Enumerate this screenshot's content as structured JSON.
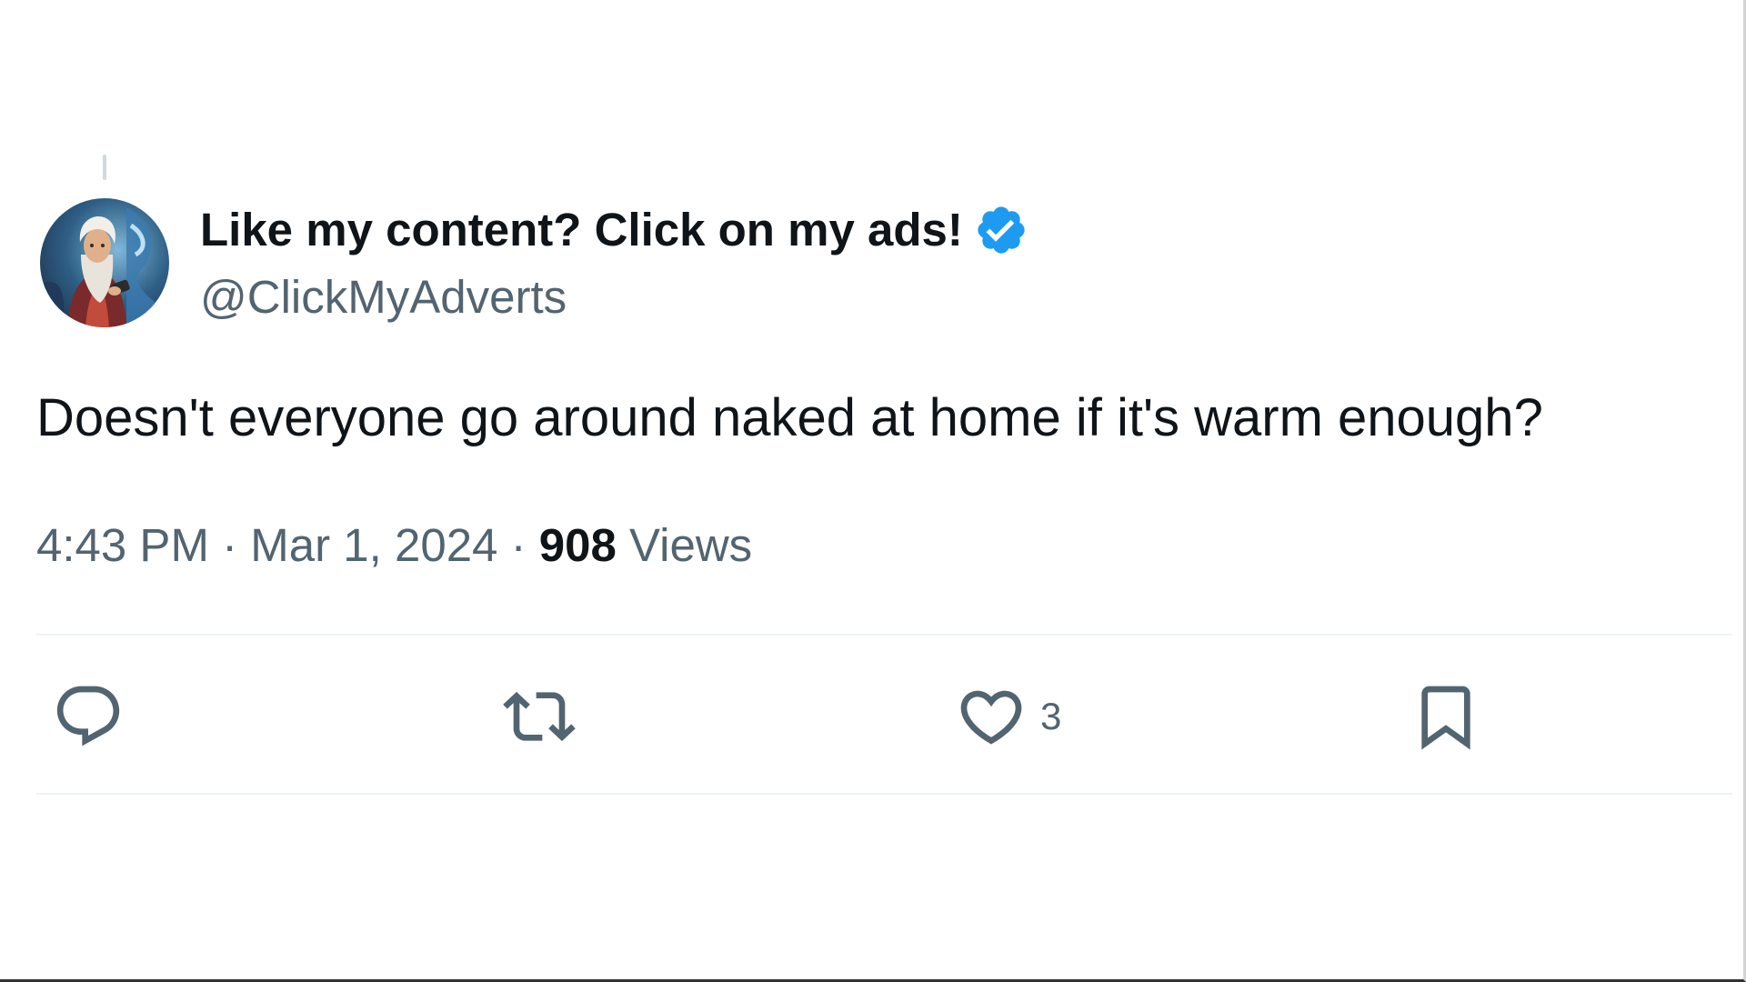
{
  "author": {
    "display_name": "Like my content? Click on my ads!",
    "handle": "@ClickMyAdverts",
    "verified": true,
    "verified_color": "#1d9bf0",
    "avatar_icon": "avatar-illustration"
  },
  "tweet": {
    "text": "Doesn't everyone go around naked at home if it's warm enough?",
    "time": "4:43 PM",
    "separator_1": "·",
    "date": "Mar 1, 2024",
    "separator_2": "·",
    "views_count": "908",
    "views_label": "Views"
  },
  "actions": {
    "reply": {
      "icon": "reply-icon",
      "count": ""
    },
    "retweet": {
      "icon": "retweet-icon",
      "count": ""
    },
    "like": {
      "icon": "heart-icon",
      "count": "3"
    },
    "bookmark": {
      "icon": "bookmark-icon",
      "count": ""
    }
  },
  "colors": {
    "text_primary": "#0f1419",
    "text_secondary": "#536471",
    "divider": "#eff3f4"
  }
}
